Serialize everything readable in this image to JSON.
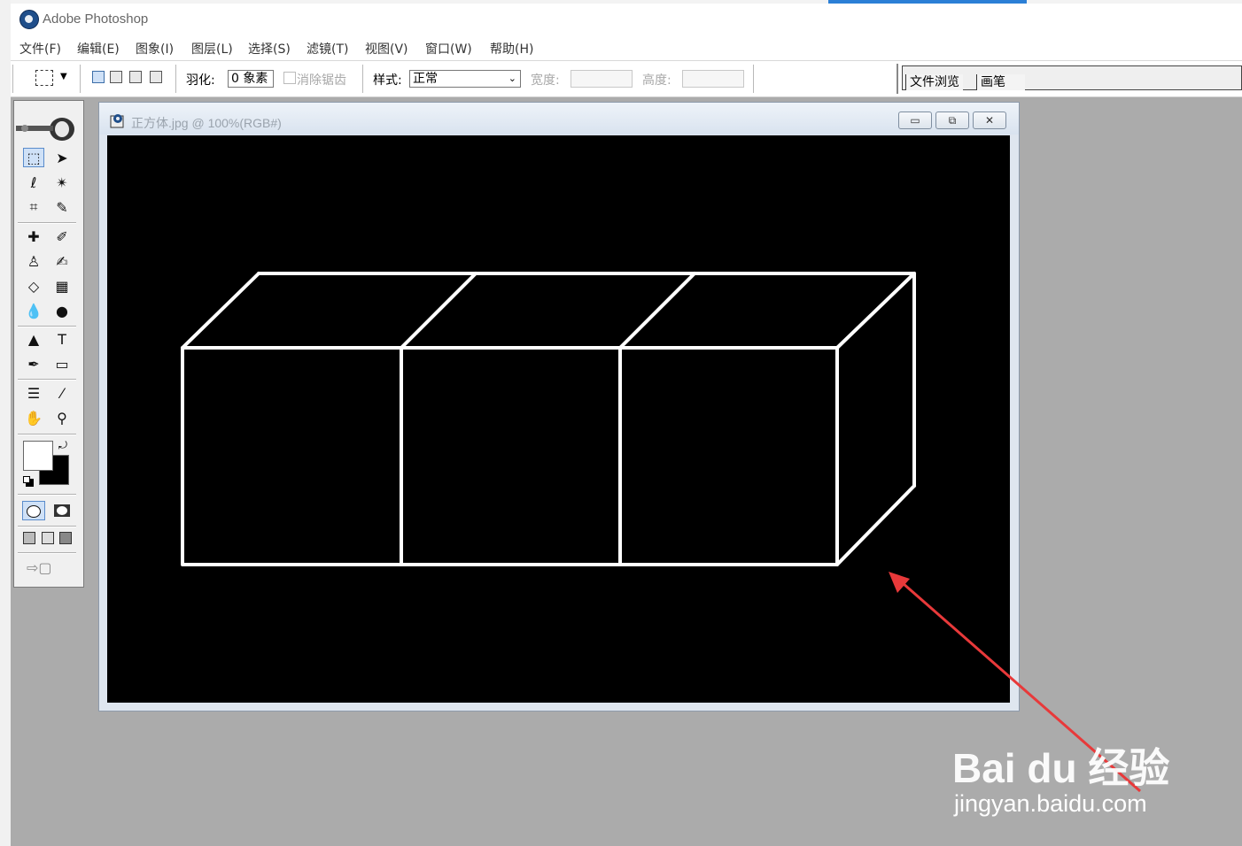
{
  "app": {
    "title": "Adobe Photoshop",
    "icon": "photoshop-icon"
  },
  "menubar": {
    "items": [
      {
        "label": "文件(F)"
      },
      {
        "label": "编辑(E)"
      },
      {
        "label": "图象(I)"
      },
      {
        "label": "图层(L)"
      },
      {
        "label": "选择(S)"
      },
      {
        "label": "滤镜(T)"
      },
      {
        "label": "视图(V)"
      },
      {
        "label": "窗口(W)"
      },
      {
        "label": "帮助(H)"
      }
    ]
  },
  "options": {
    "feather_label": "羽化:",
    "feather_value": "0 象素",
    "antialias_label": "消除锯齿",
    "antialias_checked": false,
    "style_label": "样式:",
    "style_value": "正常",
    "width_label": "宽度:",
    "height_label": "高度:"
  },
  "palette_well": {
    "tabs": [
      {
        "label": "文件浏览"
      },
      {
        "label": "画笔"
      }
    ]
  },
  "toolbox": {
    "foreground_color": "#ffffff",
    "background_color": "#000000"
  },
  "document": {
    "title": "正方体.jpg @ 100%(RGB#)"
  },
  "watermark": {
    "logo": "Bai du 经验",
    "url": "jingyan.baidu.com"
  },
  "colors": {
    "workspace": "#ababab",
    "canvas": "#000000",
    "annotation_arrow": "#e8393a",
    "selection": "#cfe1f7"
  }
}
